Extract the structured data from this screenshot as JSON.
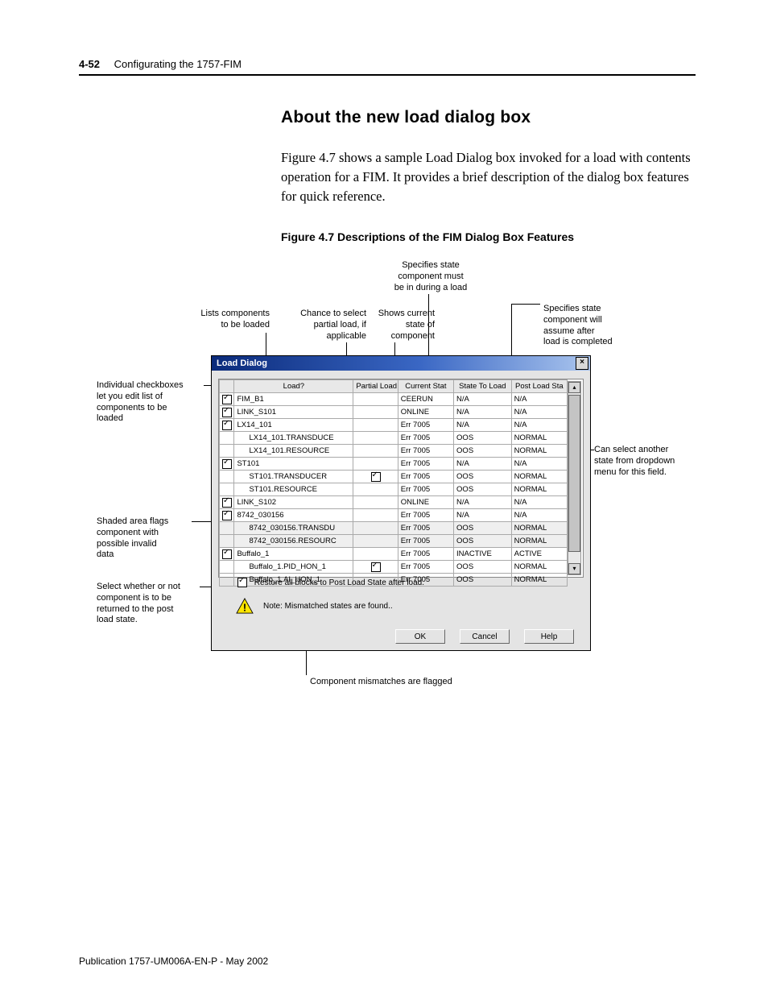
{
  "header": {
    "page_num": "4-52",
    "chapter": "Configurating the 1757-FIM"
  },
  "section_heading": "About the new load dialog box",
  "body_para": "Figure 4.7 shows a sample Load Dialog box invoked for a load with contents operation for a FIM. It provides a brief description of the dialog box features for quick reference.",
  "figure_title": "Figure 4.7 Descriptions of the FIM Dialog Box Features",
  "callouts": {
    "top_center": "Specifies state\ncomponent must\nbe in during a load",
    "top_right": "Specifies state\ncomponent will\nassume after\nload is completed",
    "lists": "Lists components\nto be loaded",
    "chance": "Chance to select\npartial load, if\napplicable",
    "shows": "Shows current\nstate of\ncomponent",
    "individual": "Individual checkboxes\nlet you edit list of\ncomponents to be\nloaded",
    "shaded": "Shaded area flags\ncomponent with\npossible invalid\ndata",
    "select": "Select whether or not\ncomponent is to be\nreturned to the post\nload state.",
    "dropdown": "Can select another\nstate from dropdown\nmenu for this field.",
    "mismatch": "Component mismatches are flagged"
  },
  "dialog": {
    "title": "Load Dialog",
    "headers": {
      "load": "Load?",
      "partial": "Partial Load",
      "current": "Current Stat",
      "state_to_load": "State To Load",
      "post": "Post Load Sta"
    },
    "rows": [
      {
        "chk": true,
        "indent": 0,
        "name": "FIM_B1",
        "pl": "",
        "cs": "CEERUN",
        "stl": "N/A",
        "post": "N/A",
        "shaded": false
      },
      {
        "chk": true,
        "indent": 0,
        "name": "LINK_S101",
        "pl": "",
        "cs": "ONLINE",
        "stl": "N/A",
        "post": "N/A",
        "shaded": false
      },
      {
        "chk": true,
        "indent": 0,
        "name": "LX14_101",
        "pl": "",
        "cs": "Err 7005",
        "stl": "N/A",
        "post": "N/A",
        "shaded": false
      },
      {
        "chk": null,
        "indent": 1,
        "name": "LX14_101.TRANSDUCE",
        "pl": "",
        "cs": "Err 7005",
        "stl": "OOS",
        "post": "NORMAL",
        "shaded": false
      },
      {
        "chk": null,
        "indent": 1,
        "name": "LX14_101.RESOURCE",
        "pl": "",
        "cs": "Err 7005",
        "stl": "OOS",
        "post": "NORMAL",
        "shaded": false
      },
      {
        "chk": true,
        "indent": 0,
        "name": "ST101",
        "pl": "",
        "cs": "Err 7005",
        "stl": "N/A",
        "post": "N/A",
        "shaded": false
      },
      {
        "chk": null,
        "indent": 1,
        "name": "ST101.TRANSDUCER",
        "pl": "cb",
        "cs": "Err 7005",
        "stl": "OOS",
        "post": "NORMAL",
        "shaded": false
      },
      {
        "chk": null,
        "indent": 1,
        "name": "ST101.RESOURCE",
        "pl": "",
        "cs": "Err 7005",
        "stl": "OOS",
        "post": "NORMAL",
        "shaded": false
      },
      {
        "chk": true,
        "indent": 0,
        "name": "LINK_S102",
        "pl": "",
        "cs": "ONLINE",
        "stl": "N/A",
        "post": "N/A",
        "shaded": false
      },
      {
        "chk": true,
        "indent": 0,
        "name": "8742_030156",
        "pl": "",
        "cs": "Err 7005",
        "stl": "N/A",
        "post": "N/A",
        "shaded": false
      },
      {
        "chk": null,
        "indent": 1,
        "name": "8742_030156.TRANSDU",
        "pl": "",
        "cs": "Err 7005",
        "stl": "OOS",
        "post": "NORMAL",
        "shaded": true
      },
      {
        "chk": null,
        "indent": 1,
        "name": "8742_030156.RESOURC",
        "pl": "",
        "cs": "Err 7005",
        "stl": "OOS",
        "post": "NORMAL",
        "shaded": true
      },
      {
        "chk": true,
        "indent": 0,
        "name": "Buffalo_1",
        "pl": "",
        "cs": "Err 7005",
        "stl": "INACTIVE",
        "post": "ACTIVE",
        "shaded": false
      },
      {
        "chk": null,
        "indent": 1,
        "name": "Buffalo_1.PID_HON_1",
        "pl": "cb",
        "cs": "Err 7005",
        "stl": "OOS",
        "post": "NORMAL",
        "shaded": false
      },
      {
        "chk": null,
        "indent": 1,
        "name": "Buffalo_1.AI_HON_1",
        "pl": "",
        "cs": "Err 7005",
        "stl": "OOS",
        "post": "NORMAL",
        "shaded": false
      }
    ],
    "restore_label": "Restore all blocks to Post Load State after load.",
    "note": "Note: Mismatched states are found..",
    "buttons": {
      "ok": "OK",
      "cancel": "Cancel",
      "help": "Help"
    }
  },
  "footer": "Publication 1757-UM006A-EN-P - May 2002"
}
